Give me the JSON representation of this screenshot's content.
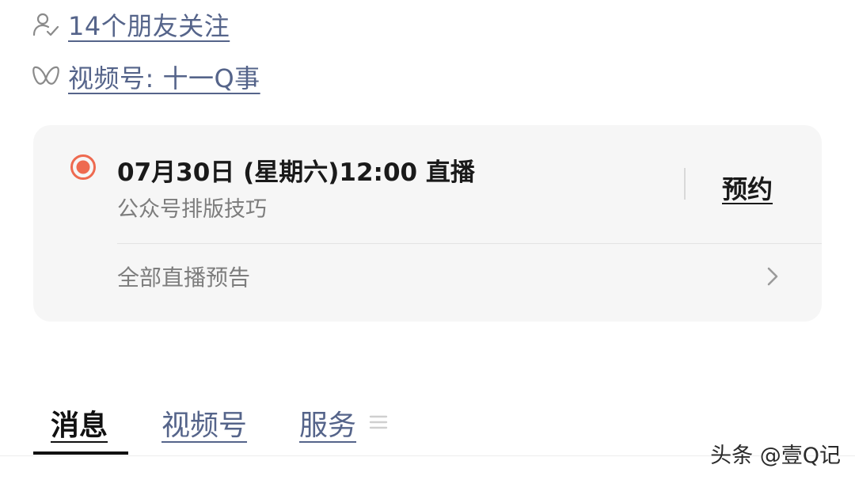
{
  "profile_links": {
    "friends": {
      "icon": "person-check-icon",
      "label": "14个朋友关注"
    },
    "channels": {
      "icon": "channels-butterfly-icon",
      "label": "视频号: 十一Q事"
    }
  },
  "live_card": {
    "status_icon": "live-record-icon",
    "accent_color": "#ee6a50",
    "title": "07月30日 (星期六)12:00 直播",
    "subtitle": "公众号排版技巧",
    "reserve_label": "预约",
    "all_label": "全部直播预告",
    "chevron_icon": "chevron-right-icon"
  },
  "tabs": [
    {
      "label": "消息",
      "active": true
    },
    {
      "label": "视频号",
      "active": false
    },
    {
      "label": "服务",
      "active": false
    }
  ],
  "tab_menu_icon": "menu-lines-icon",
  "watermark": "头条 @壹Q记"
}
